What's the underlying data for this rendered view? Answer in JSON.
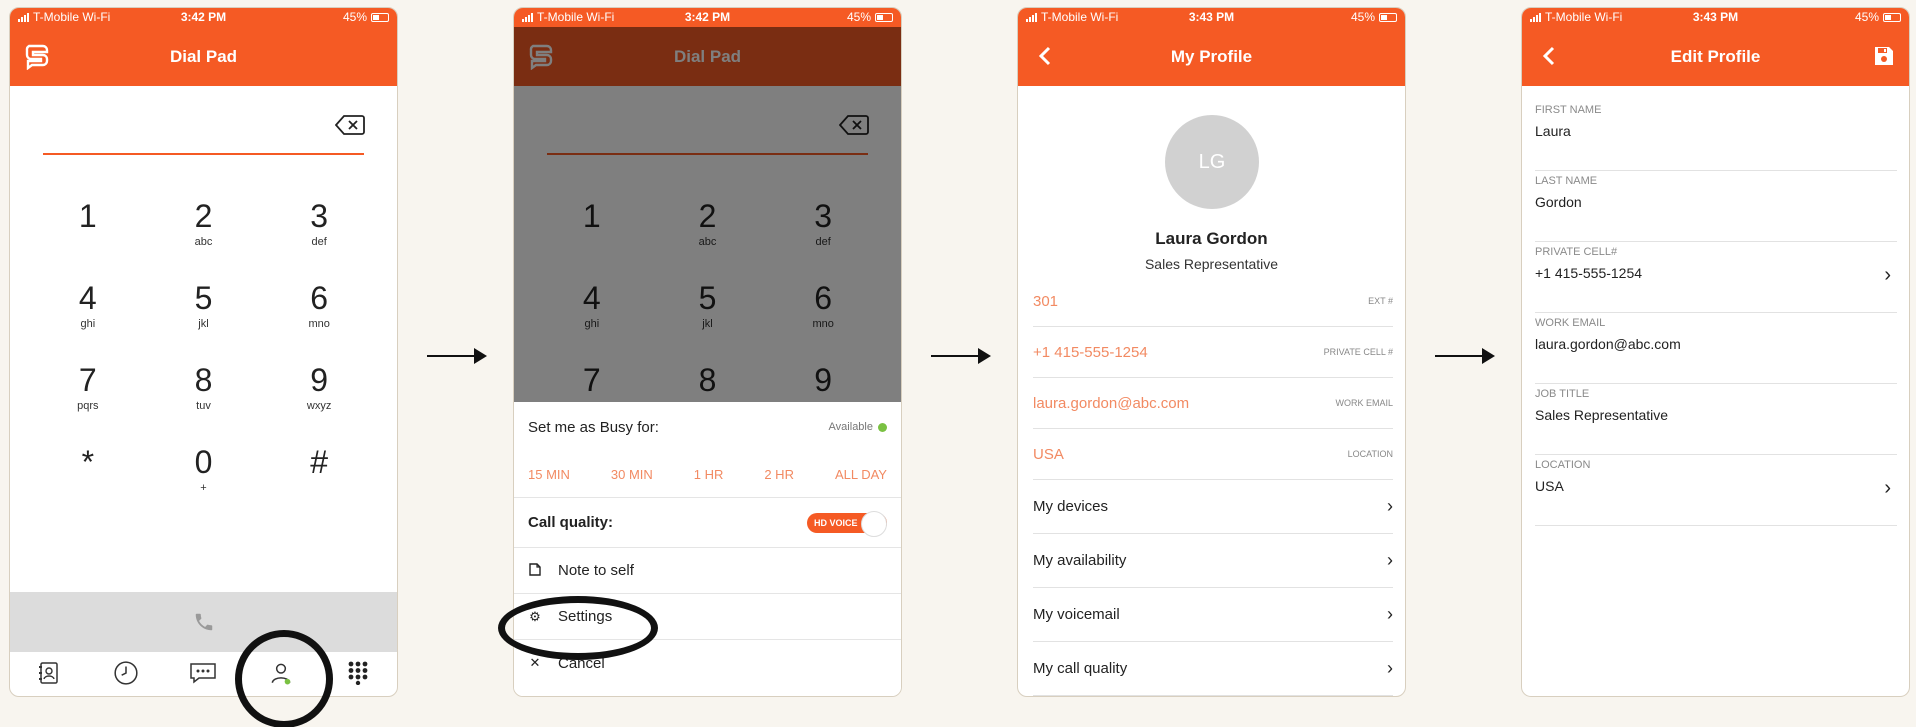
{
  "status": {
    "carrier": "T-Mobile Wi-Fi",
    "battery": "45%",
    "time1": "3:42 PM",
    "time2": "3:42 PM",
    "time3": "3:43 PM",
    "time4": "3:43 PM"
  },
  "dialpad": {
    "title": "Dial Pad",
    "keys": [
      {
        "d": "1",
        "l": ""
      },
      {
        "d": "2",
        "l": "abc"
      },
      {
        "d": "3",
        "l": "def"
      },
      {
        "d": "4",
        "l": "ghi"
      },
      {
        "d": "5",
        "l": "jkl"
      },
      {
        "d": "6",
        "l": "mno"
      },
      {
        "d": "7",
        "l": "pqrs"
      },
      {
        "d": "8",
        "l": "tuv"
      },
      {
        "d": "9",
        "l": "wxyz"
      },
      {
        "d": "*",
        "l": ""
      },
      {
        "d": "0",
        "l": "+"
      },
      {
        "d": "#",
        "l": ""
      }
    ]
  },
  "sheet": {
    "busy_title": "Set me as Busy for:",
    "availability": "Available",
    "durations": [
      "15 MIN",
      "30 MIN",
      "1 HR",
      "2 HR",
      "ALL DAY"
    ],
    "call_quality": "Call quality:",
    "hd_voice": "HD VOICE",
    "note_to_self": "Note to self",
    "settings": "Settings",
    "cancel": "Cancel"
  },
  "profile": {
    "title": "My Profile",
    "initials": "LG",
    "name": "Laura Gordon",
    "role": "Sales Representative",
    "ext_value": "301",
    "ext_label": "EXT #",
    "cell_value": "+1 415-555-1254",
    "cell_label": "PRIVATE CELL #",
    "email_value": "laura.gordon@abc.com",
    "email_label": "WORK EMAIL",
    "location_value": "USA",
    "location_label": "LOCATION",
    "nav": [
      "My devices",
      "My availability",
      "My voicemail",
      "My call quality"
    ]
  },
  "edit": {
    "title": "Edit Profile",
    "fields": [
      {
        "label": "FIRST NAME",
        "value": "Laura"
      },
      {
        "label": "LAST NAME",
        "value": "Gordon"
      },
      {
        "label": "PRIVATE CELL#",
        "value": "+1 415-555-1254"
      },
      {
        "label": "WORK EMAIL",
        "value": "laura.gordon@abc.com"
      },
      {
        "label": "JOB TITLE",
        "value": "Sales Representative"
      },
      {
        "label": "LOCATION",
        "value": "USA"
      }
    ]
  },
  "colors": {
    "brand": "#f55a24",
    "accent_text": "#f28a62",
    "status_available": "#7ac142"
  }
}
